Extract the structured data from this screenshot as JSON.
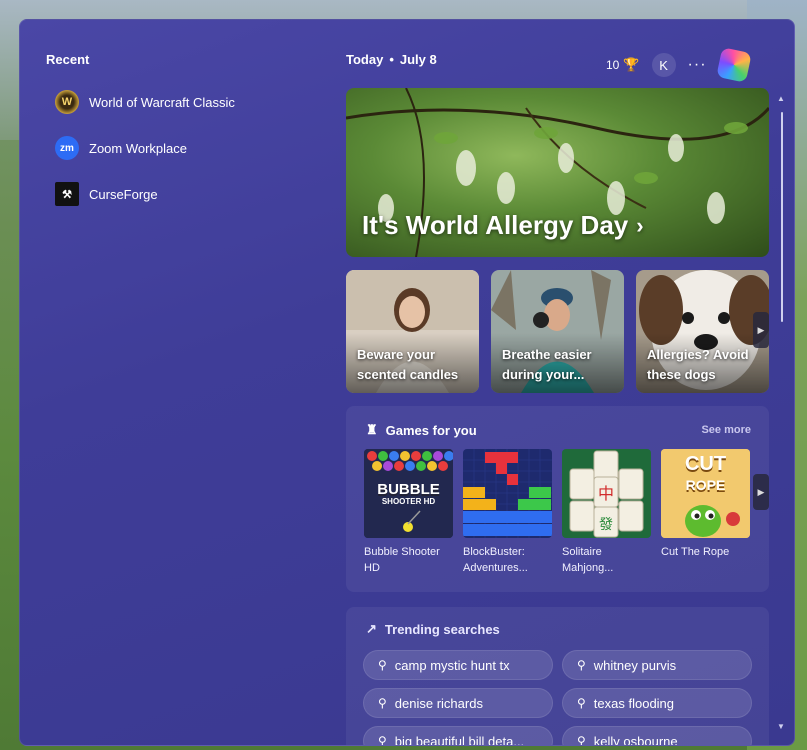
{
  "recent": {
    "title": "Recent",
    "items": [
      {
        "label": "World of Warcraft Classic",
        "icon": "wow-icon",
        "glyph": "W"
      },
      {
        "label": "Zoom Workplace",
        "icon": "zoom-icon",
        "glyph": "zm"
      },
      {
        "label": "CurseForge",
        "icon": "curseforge-icon",
        "glyph": "⚒"
      }
    ]
  },
  "header": {
    "today": "Today",
    "separator": "•",
    "date": "July 8",
    "points": "10",
    "avatar_initial": "K",
    "more": "···"
  },
  "hero": {
    "title": "It's World Allergy Day",
    "chevron": "›"
  },
  "cards": [
    {
      "label": "Beware your scented candles"
    },
    {
      "label": "Breathe easier during your..."
    },
    {
      "label": "Allergies? Avoid these dogs"
    }
  ],
  "games": {
    "title": "Games for you",
    "see_more": "See more",
    "items": [
      {
        "label": "Bubble Shooter HD",
        "art_text": "BUBBLE",
        "art_sub": "SHOOTER HD"
      },
      {
        "label": "BlockBuster: Adventures..."
      },
      {
        "label": "Solitaire Mahjong..."
      },
      {
        "label": "Cut The Rope",
        "art_text": "CUT",
        "art_sub": "ROPE"
      }
    ]
  },
  "trending": {
    "title": "Trending searches",
    "items": [
      {
        "label": "camp mystic hunt tx"
      },
      {
        "label": "whitney purvis"
      },
      {
        "label": "denise richards"
      },
      {
        "label": "texas flooding"
      },
      {
        "label": "big beautiful bill deta..."
      },
      {
        "label": "kelly osbourne"
      }
    ]
  },
  "colors": {
    "panel": "#3f3d98",
    "accent": "#4a47a6"
  }
}
